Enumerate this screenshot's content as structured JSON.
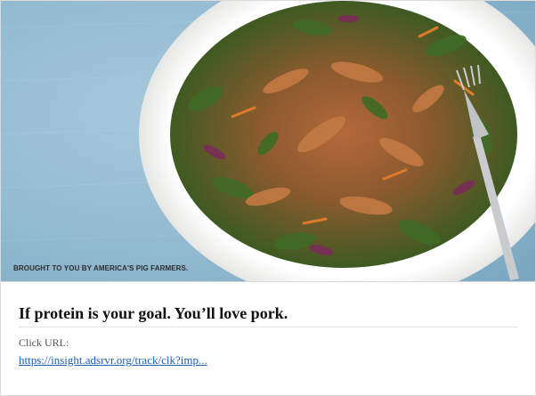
{
  "ad": {
    "image_caption": "BROUGHT TO YOU BY AMERICA'S PIG FARMERS.",
    "image_alt": "Shredded pork salad with arugula, red cabbage and carrots on a white plate with a fork",
    "headline": "If protein is your goal. You’ll love pork.",
    "click_label": "Click URL:",
    "click_url_text": "https://insight.adsrvr.org/track/clk?imp..."
  },
  "colors": {
    "tablecloth": "#8fb8cf",
    "plate": "#f4f4f2",
    "link": "#1a5fb4"
  },
  "icons": {
    "fork": "fork-icon"
  }
}
